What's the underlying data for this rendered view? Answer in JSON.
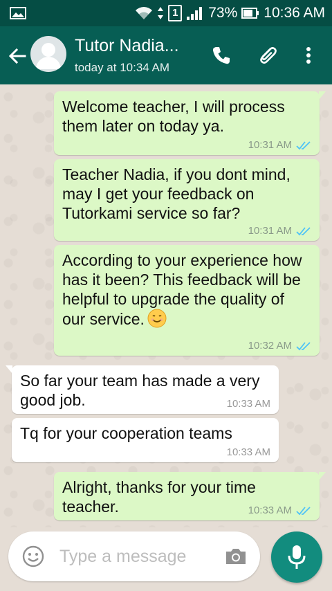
{
  "status_bar": {
    "battery": "73%",
    "time": "10:36 AM",
    "sim": "1"
  },
  "header": {
    "contact_name": "Tutor Nadia...",
    "last_seen": "today at 10:34 AM",
    "icons": [
      "back-arrow-icon",
      "avatar",
      "phone-icon",
      "attach-icon",
      "more-vert-icon"
    ]
  },
  "messages": [
    {
      "direction": "out",
      "text": "Welcome teacher, I will process them later on today ya.",
      "time": "10:31 AM",
      "read": true
    },
    {
      "direction": "out",
      "text": "Teacher Nadia, if you dont mind, may I get your feedback on Tutorkami service so far?",
      "time": "10:31 AM",
      "read": true
    },
    {
      "direction": "out",
      "text": "According to your experience how has it been? This feedback will be helpful to upgrade the quality of our service.",
      "emoji": "smiling-face",
      "time": "10:32 AM",
      "read": true
    },
    {
      "direction": "in",
      "text": "So far your team has made a very good job.",
      "time": "10:33 AM"
    },
    {
      "direction": "in",
      "text": "Tq for your cooperation teams",
      "time": "10:33 AM"
    },
    {
      "direction": "out",
      "text": "Alright, thanks for your time teacher.",
      "time": "10:33 AM",
      "read": true
    }
  ],
  "composer": {
    "placeholder": "Type a message"
  },
  "colors": {
    "header": "#075e54",
    "status_bar": "#054d44",
    "outgoing_bubble": "#dcf8c6",
    "incoming_bubble": "#ffffff",
    "read_ticks": "#4fc3f7",
    "mic_button": "#128c7e"
  }
}
